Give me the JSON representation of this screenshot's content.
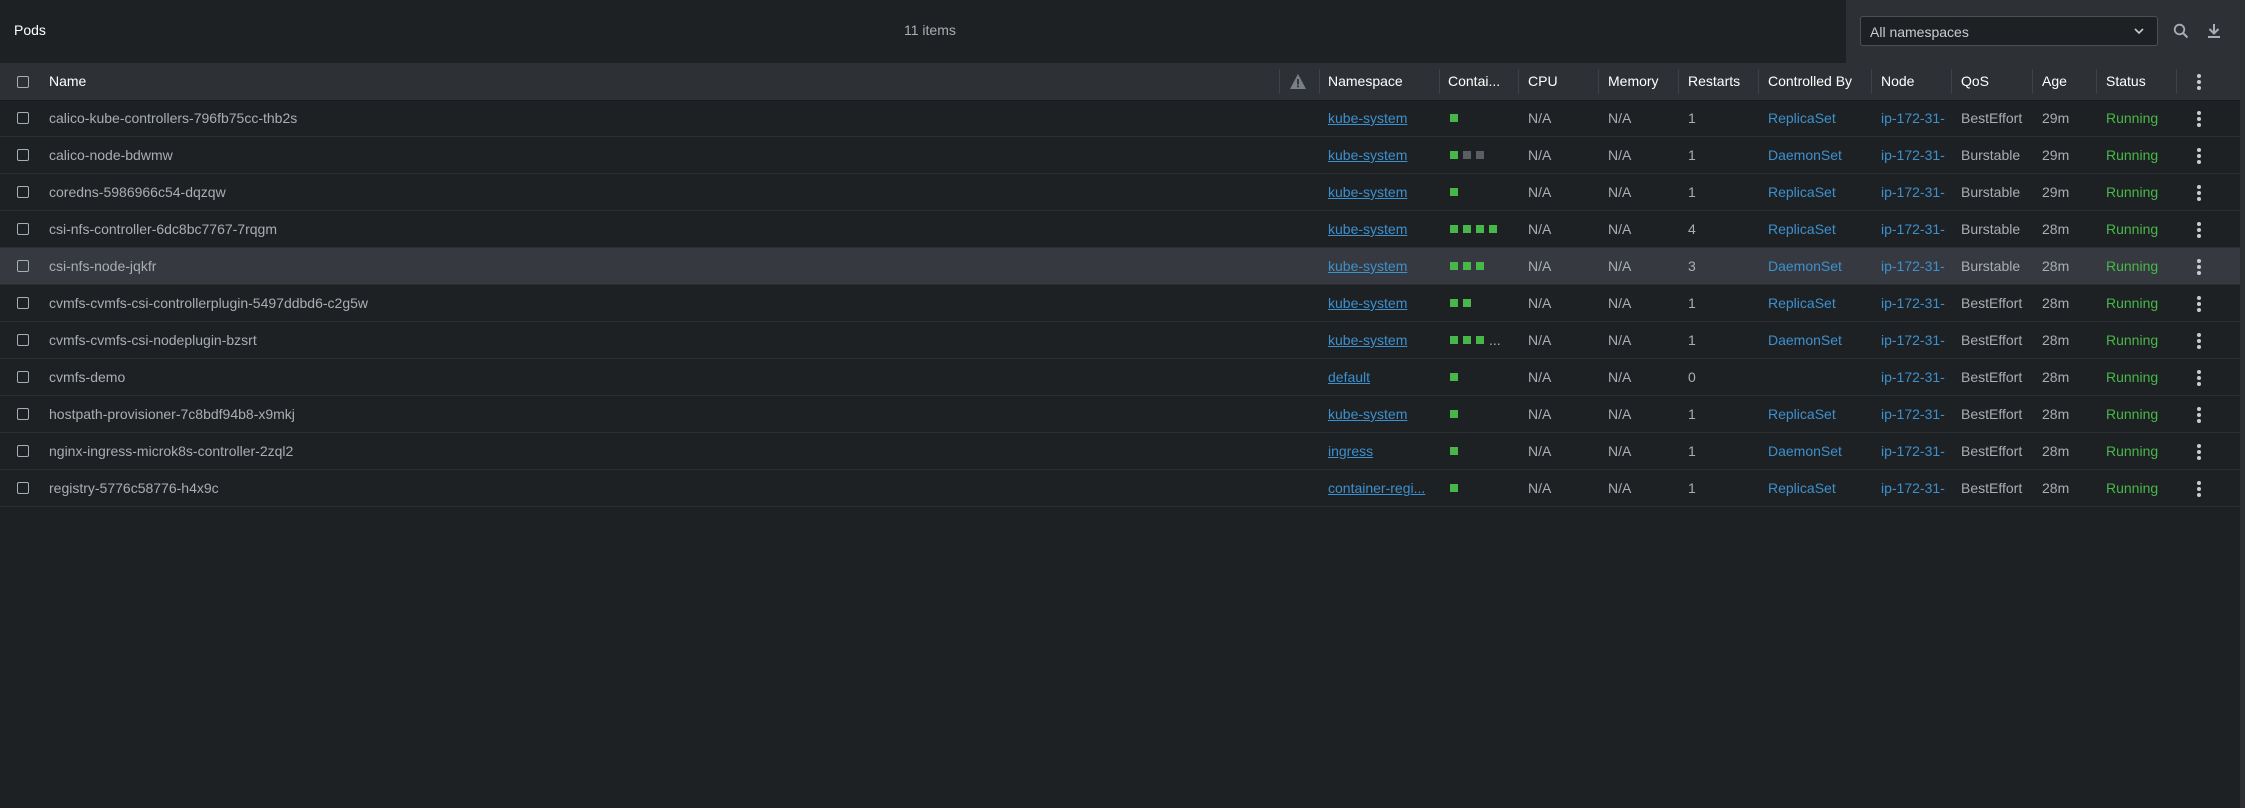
{
  "header": {
    "title": "Pods",
    "item_count": "11 items",
    "namespace_select": "All namespaces"
  },
  "columns": {
    "name": "Name",
    "namespace": "Namespace",
    "containers": "Contai...",
    "cpu": "CPU",
    "memory": "Memory",
    "restarts": "Restarts",
    "controlled_by": "Controlled By",
    "node": "Node",
    "qos": "QoS",
    "age": "Age",
    "status": "Status"
  },
  "colors": {
    "background": "#1e2124",
    "header": "#2d3136",
    "link": "#3d90ce",
    "running": "#48b749",
    "container_ready": "#48b749",
    "container_idle": "#5a5e63"
  },
  "rows": [
    {
      "name": "calico-kube-controllers-796fb75cc-thb2s",
      "namespace": "kube-system",
      "containers": [
        "on"
      ],
      "more": "",
      "cpu": "N/A",
      "memory": "N/A",
      "restarts": "1",
      "controlled_by": "ReplicaSet",
      "node": "ip-172-31-",
      "qos": "BestEffort",
      "age": "29m",
      "status": "Running"
    },
    {
      "name": "calico-node-bdwmw",
      "namespace": "kube-system",
      "containers": [
        "on",
        "off",
        "off"
      ],
      "more": "",
      "cpu": "N/A",
      "memory": "N/A",
      "restarts": "1",
      "controlled_by": "DaemonSet",
      "node": "ip-172-31-",
      "qos": "Burstable",
      "age": "29m",
      "status": "Running"
    },
    {
      "name": "coredns-5986966c54-dqzqw",
      "namespace": "kube-system",
      "containers": [
        "on"
      ],
      "more": "",
      "cpu": "N/A",
      "memory": "N/A",
      "restarts": "1",
      "controlled_by": "ReplicaSet",
      "node": "ip-172-31-",
      "qos": "Burstable",
      "age": "29m",
      "status": "Running"
    },
    {
      "name": "csi-nfs-controller-6dc8bc7767-7rqgm",
      "namespace": "kube-system",
      "containers": [
        "on",
        "on",
        "on",
        "on"
      ],
      "more": "",
      "cpu": "N/A",
      "memory": "N/A",
      "restarts": "4",
      "controlled_by": "ReplicaSet",
      "node": "ip-172-31-",
      "qos": "Burstable",
      "age": "28m",
      "status": "Running"
    },
    {
      "name": "csi-nfs-node-jqkfr",
      "namespace": "kube-system",
      "containers": [
        "on",
        "on",
        "on"
      ],
      "more": "",
      "cpu": "N/A",
      "memory": "N/A",
      "restarts": "3",
      "controlled_by": "DaemonSet",
      "node": "ip-172-31-",
      "qos": "Burstable",
      "age": "28m",
      "status": "Running",
      "selected": true
    },
    {
      "name": "cvmfs-cvmfs-csi-controllerplugin-5497ddbd6-c2g5w",
      "namespace": "kube-system",
      "containers": [
        "on",
        "on"
      ],
      "more": "",
      "cpu": "N/A",
      "memory": "N/A",
      "restarts": "1",
      "controlled_by": "ReplicaSet",
      "node": "ip-172-31-",
      "qos": "BestEffort",
      "age": "28m",
      "status": "Running"
    },
    {
      "name": "cvmfs-cvmfs-csi-nodeplugin-bzsrt",
      "namespace": "kube-system",
      "containers": [
        "on",
        "on",
        "on"
      ],
      "more": "...",
      "cpu": "N/A",
      "memory": "N/A",
      "restarts": "1",
      "controlled_by": "DaemonSet",
      "node": "ip-172-31-",
      "qos": "BestEffort",
      "age": "28m",
      "status": "Running"
    },
    {
      "name": "cvmfs-demo",
      "namespace": "default",
      "containers": [
        "on"
      ],
      "more": "",
      "cpu": "N/A",
      "memory": "N/A",
      "restarts": "0",
      "controlled_by": "",
      "node": "ip-172-31-",
      "qos": "BestEffort",
      "age": "28m",
      "status": "Running"
    },
    {
      "name": "hostpath-provisioner-7c8bdf94b8-x9mkj",
      "namespace": "kube-system",
      "containers": [
        "on"
      ],
      "more": "",
      "cpu": "N/A",
      "memory": "N/A",
      "restarts": "1",
      "controlled_by": "ReplicaSet",
      "node": "ip-172-31-",
      "qos": "BestEffort",
      "age": "28m",
      "status": "Running"
    },
    {
      "name": "nginx-ingress-microk8s-controller-2zql2",
      "namespace": "ingress",
      "containers": [
        "on"
      ],
      "more": "",
      "cpu": "N/A",
      "memory": "N/A",
      "restarts": "1",
      "controlled_by": "DaemonSet",
      "node": "ip-172-31-",
      "qos": "BestEffort",
      "age": "28m",
      "status": "Running"
    },
    {
      "name": "registry-5776c58776-h4x9c",
      "namespace": "container-regi...",
      "containers": [
        "on"
      ],
      "more": "",
      "cpu": "N/A",
      "memory": "N/A",
      "restarts": "1",
      "controlled_by": "ReplicaSet",
      "node": "ip-172-31-",
      "qos": "BestEffort",
      "age": "28m",
      "status": "Running"
    }
  ]
}
